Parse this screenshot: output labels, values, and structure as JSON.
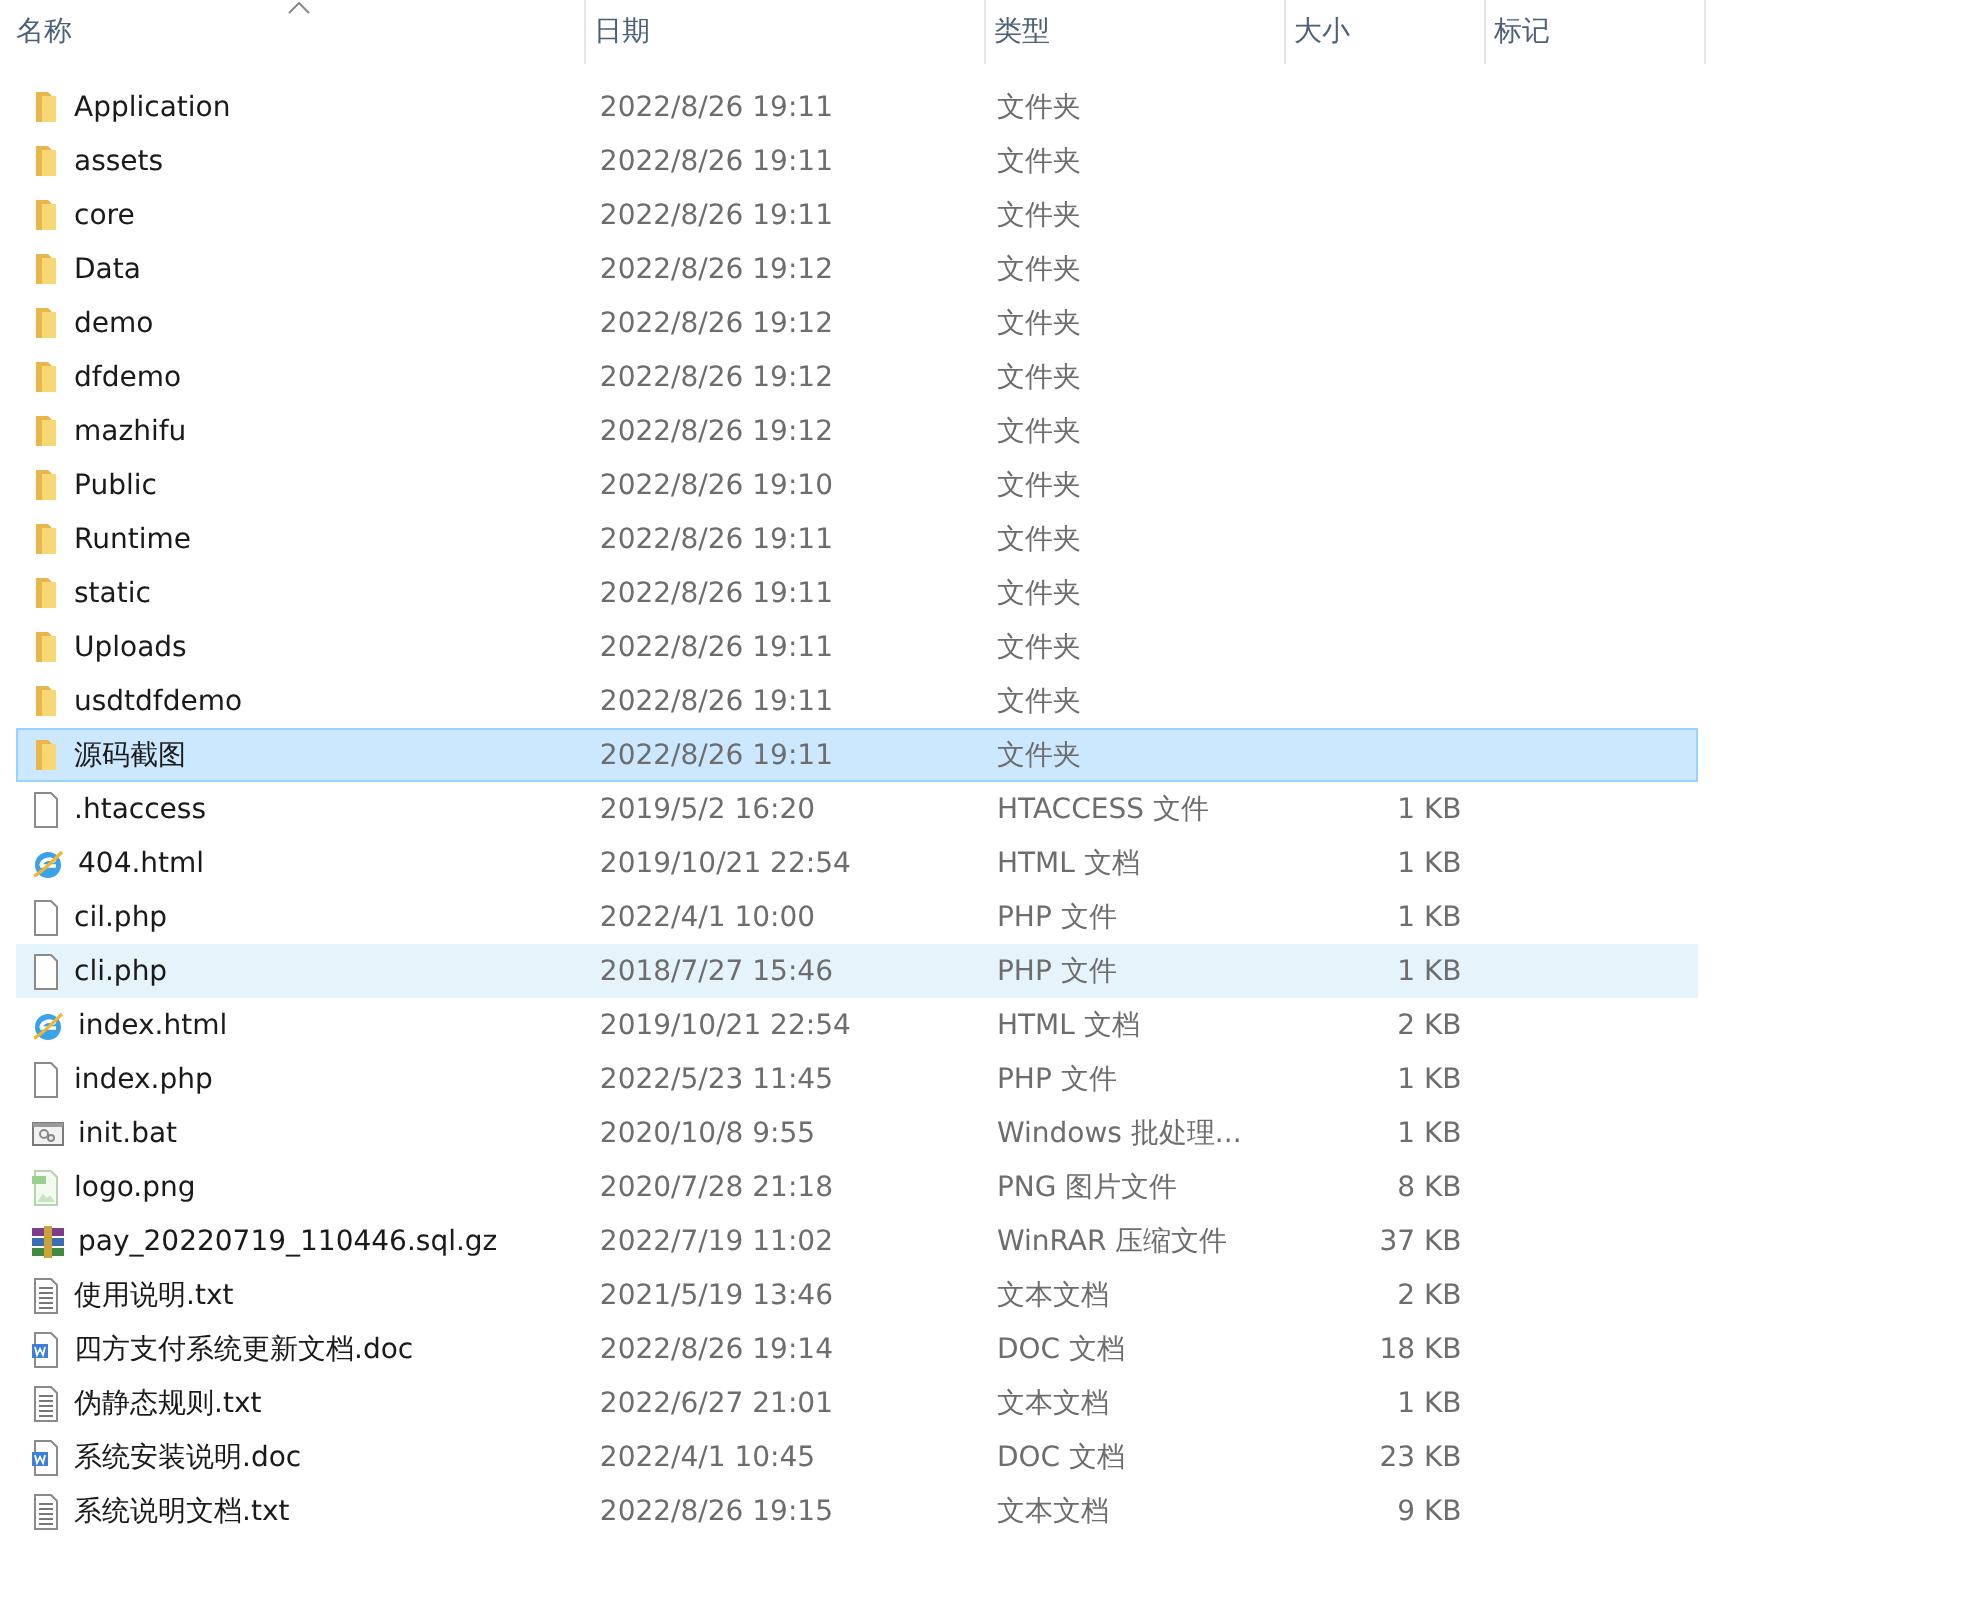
{
  "columns": [
    {
      "label": "名称",
      "sorted": true
    },
    {
      "label": "日期",
      "sorted": false
    },
    {
      "label": "类型",
      "sorted": false
    },
    {
      "label": "大小",
      "sorted": false
    },
    {
      "label": "标记",
      "sorted": false
    }
  ],
  "rows": [
    {
      "kind": "folder",
      "name": "Application",
      "date": "2022/8/26 19:11",
      "type": "文件夹",
      "selected": false,
      "hovered": false
    },
    {
      "kind": "folder",
      "name": "assets",
      "date": "2022/8/26 19:11",
      "type": "文件夹",
      "selected": false,
      "hovered": false
    },
    {
      "kind": "folder",
      "name": "core",
      "date": "2022/8/26 19:11",
      "type": "文件夹",
      "selected": false,
      "hovered": false
    },
    {
      "kind": "folder",
      "name": "Data",
      "date": "2022/8/26 19:12",
      "type": "文件夹",
      "selected": false,
      "hovered": false
    },
    {
      "kind": "folder",
      "name": "demo",
      "date": "2022/8/26 19:12",
      "type": "文件夹",
      "selected": false,
      "hovered": false
    },
    {
      "kind": "folder",
      "name": "dfdemo",
      "date": "2022/8/26 19:12",
      "type": "文件夹",
      "selected": false,
      "hovered": false
    },
    {
      "kind": "folder",
      "name": "mazhifu",
      "date": "2022/8/26 19:12",
      "type": "文件夹",
      "selected": false,
      "hovered": false
    },
    {
      "kind": "folder",
      "name": "Public",
      "date": "2022/8/26 19:10",
      "type": "文件夹",
      "selected": false,
      "hovered": false
    },
    {
      "kind": "folder",
      "name": "Runtime",
      "date": "2022/8/26 19:11",
      "type": "文件夹",
      "selected": false,
      "hovered": false
    },
    {
      "kind": "folder",
      "name": "static",
      "date": "2022/8/26 19:11",
      "type": "文件夹",
      "selected": false,
      "hovered": false
    },
    {
      "kind": "folder",
      "name": "Uploads",
      "date": "2022/8/26 19:11",
      "type": "文件夹",
      "selected": false,
      "hovered": false
    },
    {
      "kind": "folder",
      "name": "usdtdfdemo",
      "date": "2022/8/26 19:11",
      "type": "文件夹",
      "selected": false,
      "hovered": false
    },
    {
      "kind": "folder",
      "name": "源码截图",
      "date": "2022/8/26 19:11",
      "type": "文件夹",
      "selected": true,
      "hovered": false
    },
    {
      "kind": "file",
      "name": ".htaccess",
      "date": "2019/5/2 16:20",
      "type": "HTACCESS 文件",
      "size": "1 KB",
      "selected": false,
      "hovered": false
    },
    {
      "kind": "web",
      "name": "404.html",
      "date": "2019/10/21 22:54",
      "type": "HTML 文档",
      "size": "1 KB",
      "selected": false,
      "hovered": false
    },
    {
      "kind": "file",
      "name": "cil.php",
      "date": "2022/4/1 10:00",
      "type": "PHP 文件",
      "size": "1 KB",
      "selected": false,
      "hovered": false
    },
    {
      "kind": "file",
      "name": "cli.php",
      "date": "2018/7/27 15:46",
      "type": "PHP 文件",
      "size": "1 KB",
      "selected": false,
      "hovered": true
    },
    {
      "kind": "web",
      "name": "index.html",
      "date": "2019/10/21 22:54",
      "type": "HTML 文档",
      "size": "2 KB",
      "selected": false,
      "hovered": false
    },
    {
      "kind": "file",
      "name": "index.php",
      "date": "2022/5/23 11:45",
      "type": "PHP 文件",
      "size": "1 KB",
      "selected": false,
      "hovered": false
    },
    {
      "kind": "batch",
      "name": "init.bat",
      "date": "2020/10/8 9:55",
      "type": "Windows 批处理...",
      "size": "1 KB",
      "selected": false,
      "hovered": false
    },
    {
      "kind": "image",
      "name": "logo.png",
      "date": "2020/7/28 21:18",
      "type": "PNG 图片文件",
      "size": "8 KB",
      "selected": false,
      "hovered": false
    },
    {
      "kind": "archive",
      "name": "pay_20220719_110446.sql.gz",
      "date": "2022/7/19 11:02",
      "type": "WinRAR 压缩文件",
      "size": "37 KB",
      "selected": false,
      "hovered": false
    },
    {
      "kind": "text",
      "name": "使用说明.txt",
      "date": "2021/5/19 13:46",
      "type": "文本文档",
      "size": "2 KB",
      "selected": false,
      "hovered": false
    },
    {
      "kind": "doc",
      "name": "四方支付系统更新文档.doc",
      "date": "2022/8/26 19:14",
      "type": "DOC 文档",
      "size": "18 KB",
      "selected": false,
      "hovered": false
    },
    {
      "kind": "text",
      "name": "伪静态规则.txt",
      "date": "2022/6/27 21:01",
      "type": "文本文档",
      "size": "1 KB",
      "selected": false,
      "hovered": false
    },
    {
      "kind": "doc",
      "name": "系统安装说明.doc",
      "date": "2022/4/1 10:45",
      "type": "DOC 文档",
      "size": "23 KB",
      "selected": false,
      "hovered": false
    },
    {
      "kind": "text",
      "name": "系统说明文档.txt",
      "date": "2022/8/26 19:15",
      "type": "文本文档",
      "size": "9 KB",
      "selected": false,
      "hovered": false
    }
  ]
}
